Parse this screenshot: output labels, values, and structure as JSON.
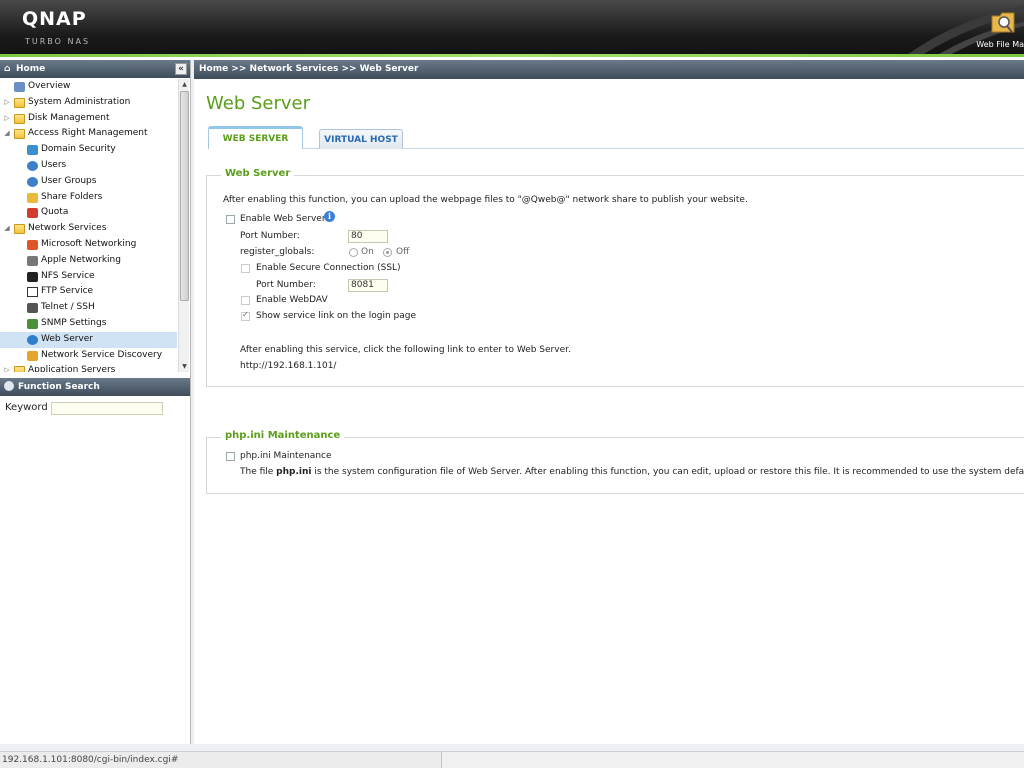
{
  "header": {
    "logo": "QNAP",
    "logo_sub": "TURBO NAS",
    "web_file_manager": "Web File Ma"
  },
  "sidebar": {
    "title": "Home",
    "collapse_label": "«",
    "tree": [
      {
        "label": "Overview",
        "level": 0,
        "arrow": "",
        "icon": "overview-icon"
      },
      {
        "label": "System Administration",
        "level": 0,
        "arrow": "▷",
        "icon": "folder-icon"
      },
      {
        "label": "Disk Management",
        "level": 0,
        "arrow": "▷",
        "icon": "folder-icon"
      },
      {
        "label": "Access Right Management",
        "level": 0,
        "arrow": "◢",
        "icon": "folder-open-icon"
      },
      {
        "label": "Domain Security",
        "level": 1,
        "icon": "domain-security-icon"
      },
      {
        "label": "Users",
        "level": 1,
        "icon": "user-icon"
      },
      {
        "label": "User Groups",
        "level": 1,
        "icon": "user-groups-icon"
      },
      {
        "label": "Share Folders",
        "level": 1,
        "icon": "share-folder-icon"
      },
      {
        "label": "Quota",
        "level": 1,
        "icon": "quota-icon"
      },
      {
        "label": "Network Services",
        "level": 0,
        "arrow": "◢",
        "icon": "folder-open-icon"
      },
      {
        "label": "Microsoft Networking",
        "level": 1,
        "icon": "windows-icon"
      },
      {
        "label": "Apple Networking",
        "level": 1,
        "icon": "apple-icon"
      },
      {
        "label": "NFS Service",
        "level": 1,
        "icon": "linux-penguin-icon"
      },
      {
        "label": "FTP Service",
        "level": 1,
        "icon": "ftp-icon"
      },
      {
        "label": "Telnet / SSH",
        "level": 1,
        "icon": "terminal-icon"
      },
      {
        "label": "SNMP Settings",
        "level": 1,
        "icon": "snmp-icon"
      },
      {
        "label": "Web Server",
        "level": 1,
        "icon": "globe-icon",
        "selected": true
      },
      {
        "label": "Network Service Discovery",
        "level": 1,
        "icon": "discovery-icon"
      },
      {
        "label": "Application Servers",
        "level": 0,
        "arrow": "▷",
        "icon": "folder-icon"
      }
    ],
    "function_search_title": "Function Search",
    "keyword_label": "Keyword :",
    "keyword_value": ""
  },
  "breadcrumb": "Home >> Network Services >> Web Server",
  "page_title": "Web Server",
  "tabs": [
    {
      "label": "WEB SERVER",
      "active": true
    },
    {
      "label": "VIRTUAL HOST",
      "active": false
    }
  ],
  "web_server_group": {
    "title": "Web Server",
    "description": "After enabling this function, you can upload the webpage files to \"@Qweb@\" network share to publish your website.",
    "enable_label": "Enable Web Server",
    "enable_checked": false,
    "port_label": "Port Number:",
    "port_value": "80",
    "register_globals_label": "register_globals:",
    "on_label": "On",
    "off_label": "Off",
    "register_globals_value": "Off",
    "ssl_label": "Enable Secure Connection (SSL)",
    "ssl_port_label": "Port Number:",
    "ssl_port_value": "8081",
    "webdav_label": "Enable WebDAV",
    "show_link_label": "Show service link on the login page",
    "show_link_checked": true,
    "after_text": "After enabling this service, click the following link to enter to Web Server.",
    "url": "http://192.168.1.101/"
  },
  "php_group": {
    "title": "php.ini Maintenance",
    "checkbox_label": "php.ini Maintenance",
    "desc_prefix": "The file ",
    "desc_bold": "php.ini",
    "desc_suffix": " is the system configuration file of Web Server. After enabling this function, you can edit, upload or restore this file. It is recommended to use the system default setting."
  },
  "statusbar": {
    "url": "192.168.1.101:8080/cgi-bin/index.cgi#"
  }
}
